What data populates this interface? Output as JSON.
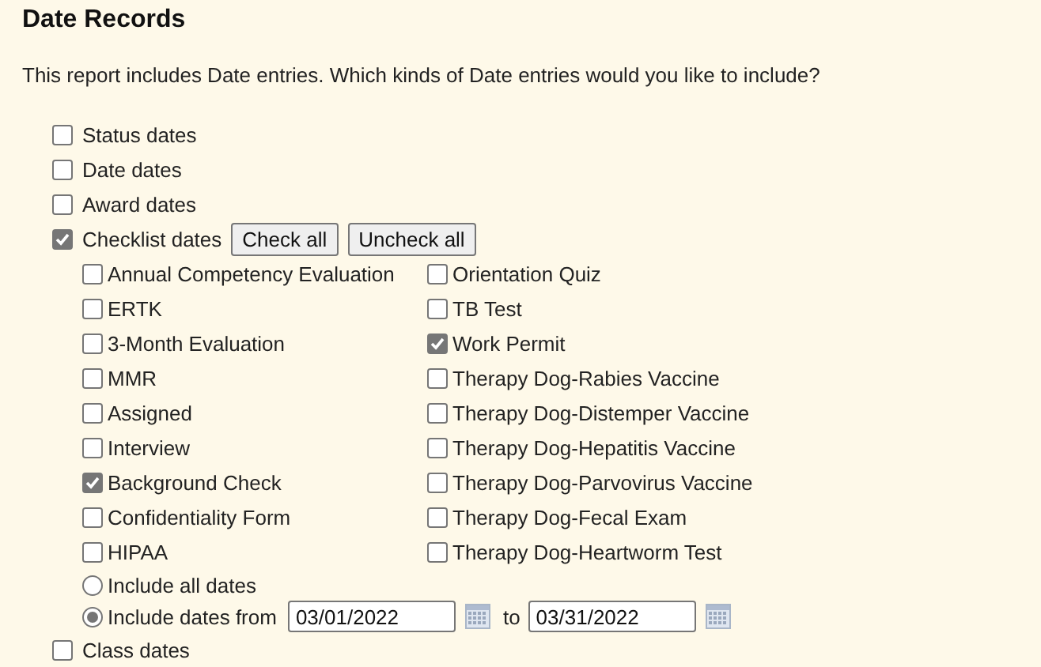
{
  "heading": "Date Records",
  "intro": "This report includes Date entries. Which kinds of Date entries would you like to include?",
  "record_types": [
    {
      "label": "Status dates",
      "checked": false
    },
    {
      "label": "Date dates",
      "checked": false
    },
    {
      "label": "Award dates",
      "checked": false
    },
    {
      "label": "Checklist dates",
      "checked": true,
      "buttons": [
        "Check all",
        "Uncheck all"
      ],
      "items": [
        {
          "label": "Annual Competency Evaluation",
          "checked": false
        },
        {
          "label": "ERTK",
          "checked": false
        },
        {
          "label": "3-Month Evaluation",
          "checked": false
        },
        {
          "label": "MMR",
          "checked": false
        },
        {
          "label": "Assigned",
          "checked": false
        },
        {
          "label": "Interview",
          "checked": false
        },
        {
          "label": "Background Check",
          "checked": true
        },
        {
          "label": "Confidentiality Form",
          "checked": false
        },
        {
          "label": "HIPAA",
          "checked": false
        },
        {
          "label": "Orientation Quiz",
          "checked": false
        },
        {
          "label": "TB Test",
          "checked": false
        },
        {
          "label": "Work Permit",
          "checked": true
        },
        {
          "label": "Therapy Dog-Rabies Vaccine",
          "checked": false
        },
        {
          "label": "Therapy Dog-Distemper Vaccine",
          "checked": false
        },
        {
          "label": "Therapy Dog-Hepatitis Vaccine",
          "checked": false
        },
        {
          "label": "Therapy Dog-Parvovirus Vaccine",
          "checked": false
        },
        {
          "label": "Therapy Dog-Fecal Exam",
          "checked": false
        },
        {
          "label": "Therapy Dog-Heartworm Test",
          "checked": false
        }
      ],
      "range_options": [
        {
          "kind": "all",
          "label": "Include all dates",
          "selected": false
        },
        {
          "kind": "range",
          "label": "Include dates from",
          "selected": true,
          "from": "03/01/2022",
          "separator": "to",
          "to": "03/31/2022"
        }
      ]
    },
    {
      "label": "Class dates",
      "checked": false
    }
  ]
}
